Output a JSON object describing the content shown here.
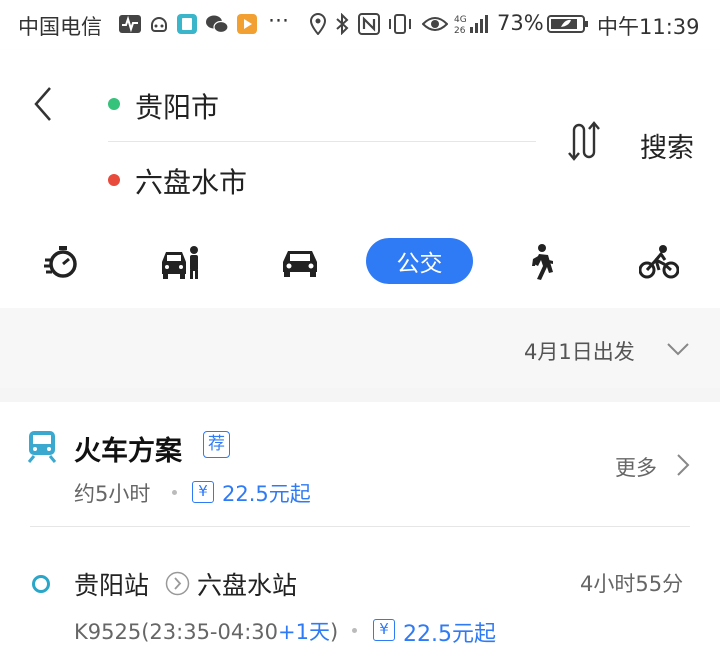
{
  "status_bar": {
    "carrier": "中国电信",
    "battery": "73%",
    "time": "中午11:39",
    "icons": [
      "activity-icon",
      "assistant-icon",
      "book-icon",
      "wechat-icon",
      "play-icon",
      "more-dots-icon",
      "location-icon",
      "bluetooth-icon",
      "nfc-icon",
      "vibrate-icon",
      "eye-icon",
      "signal-icon",
      "battery-icon"
    ]
  },
  "route": {
    "origin": "贵阳市",
    "destination": "六盘水市",
    "origin_color": "#35c27a",
    "destination_color": "#e84a3c",
    "search_label": "搜索"
  },
  "modes": {
    "items": [
      "recommend-icon",
      "taxi-icon",
      "car-icon",
      "bus",
      "walk-icon",
      "bike-icon"
    ],
    "active_label": "公交",
    "accent": "#2f7af5"
  },
  "date": {
    "label": "4月1日出发"
  },
  "train_plan": {
    "title": "火车方案",
    "badge": "荐",
    "duration_summary": "约5小时",
    "yen": "¥",
    "price_summary": "22.5元起",
    "more_label": "更多",
    "route": {
      "from": "贵阳站",
      "to": "六盘水站",
      "duration": "4小时55分",
      "train_info": "K9525(23:35-04:30",
      "plus_day": "+1天",
      "close_paren": ")",
      "price": "22.5元起"
    }
  }
}
